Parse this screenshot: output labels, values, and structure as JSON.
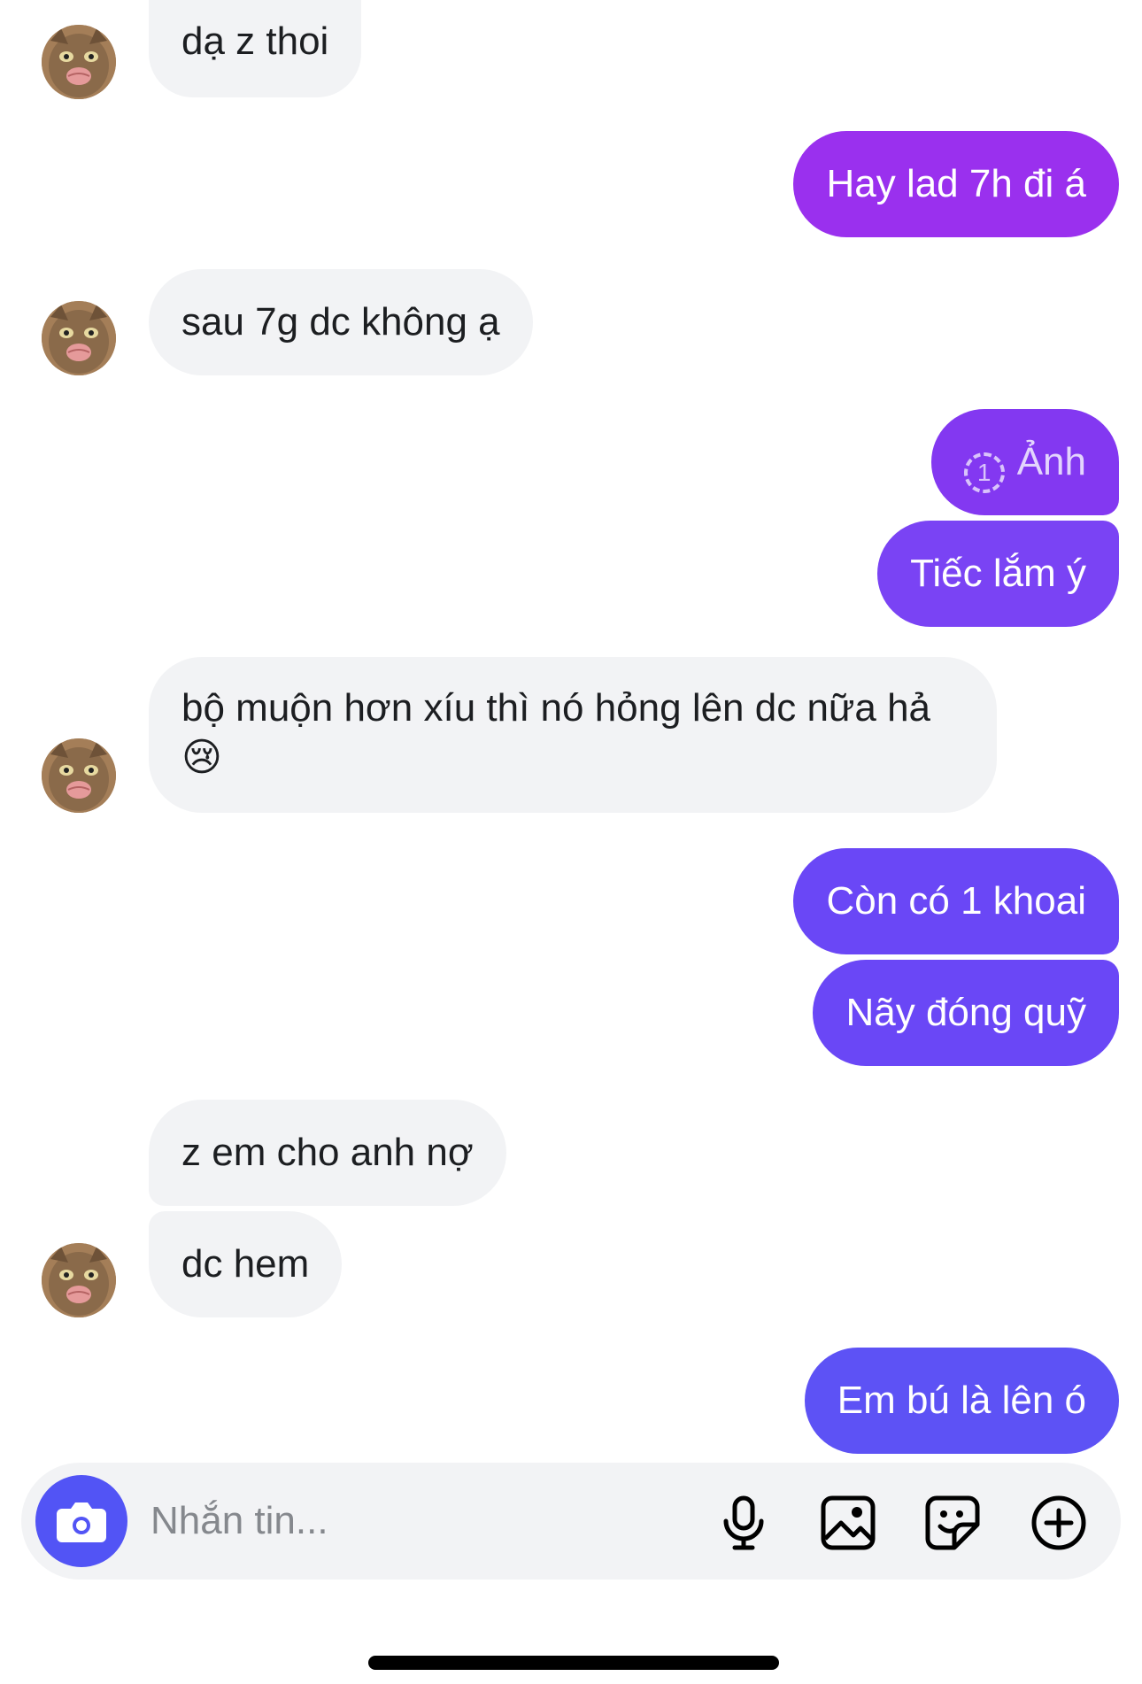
{
  "contact": {
    "avatar_icon": "cat-avatar-icon"
  },
  "messages": [
    {
      "side": "in",
      "text": "dạ z thoi"
    },
    {
      "side": "out",
      "text": "Hay lad 7h đi á"
    },
    {
      "side": "in",
      "text": "sau 7g dc không ạ"
    },
    {
      "side": "out",
      "type": "view-once-photo",
      "count": "1",
      "text": "Ảnh"
    },
    {
      "side": "out",
      "text": "Tiếc lắm ý"
    },
    {
      "side": "in",
      "text": "bộ muộn hơn xíu thì nó hỏng lên dc nữa hả",
      "emoji": "😢"
    },
    {
      "side": "out",
      "text": "Còn có 1 khoai"
    },
    {
      "side": "out",
      "text": "Nãy đóng quỹ"
    },
    {
      "side": "in",
      "text": "z em cho anh nợ"
    },
    {
      "side": "in",
      "text": "dc hem"
    },
    {
      "side": "out",
      "text": "Em bú là lên ó"
    }
  ],
  "composer": {
    "placeholder": "Nhắn tin...",
    "icons": [
      "camera-icon",
      "microphone-icon",
      "gallery-icon",
      "sticker-icon",
      "plus-icon"
    ]
  },
  "colors": {
    "incoming_bubble": "#f2f3f5",
    "outgoing_gradient": [
      "#9a30ee",
      "#8338f1",
      "#7a43f4",
      "#6a47f6",
      "#5d52f5"
    ],
    "camera_button": "#5254f5"
  }
}
